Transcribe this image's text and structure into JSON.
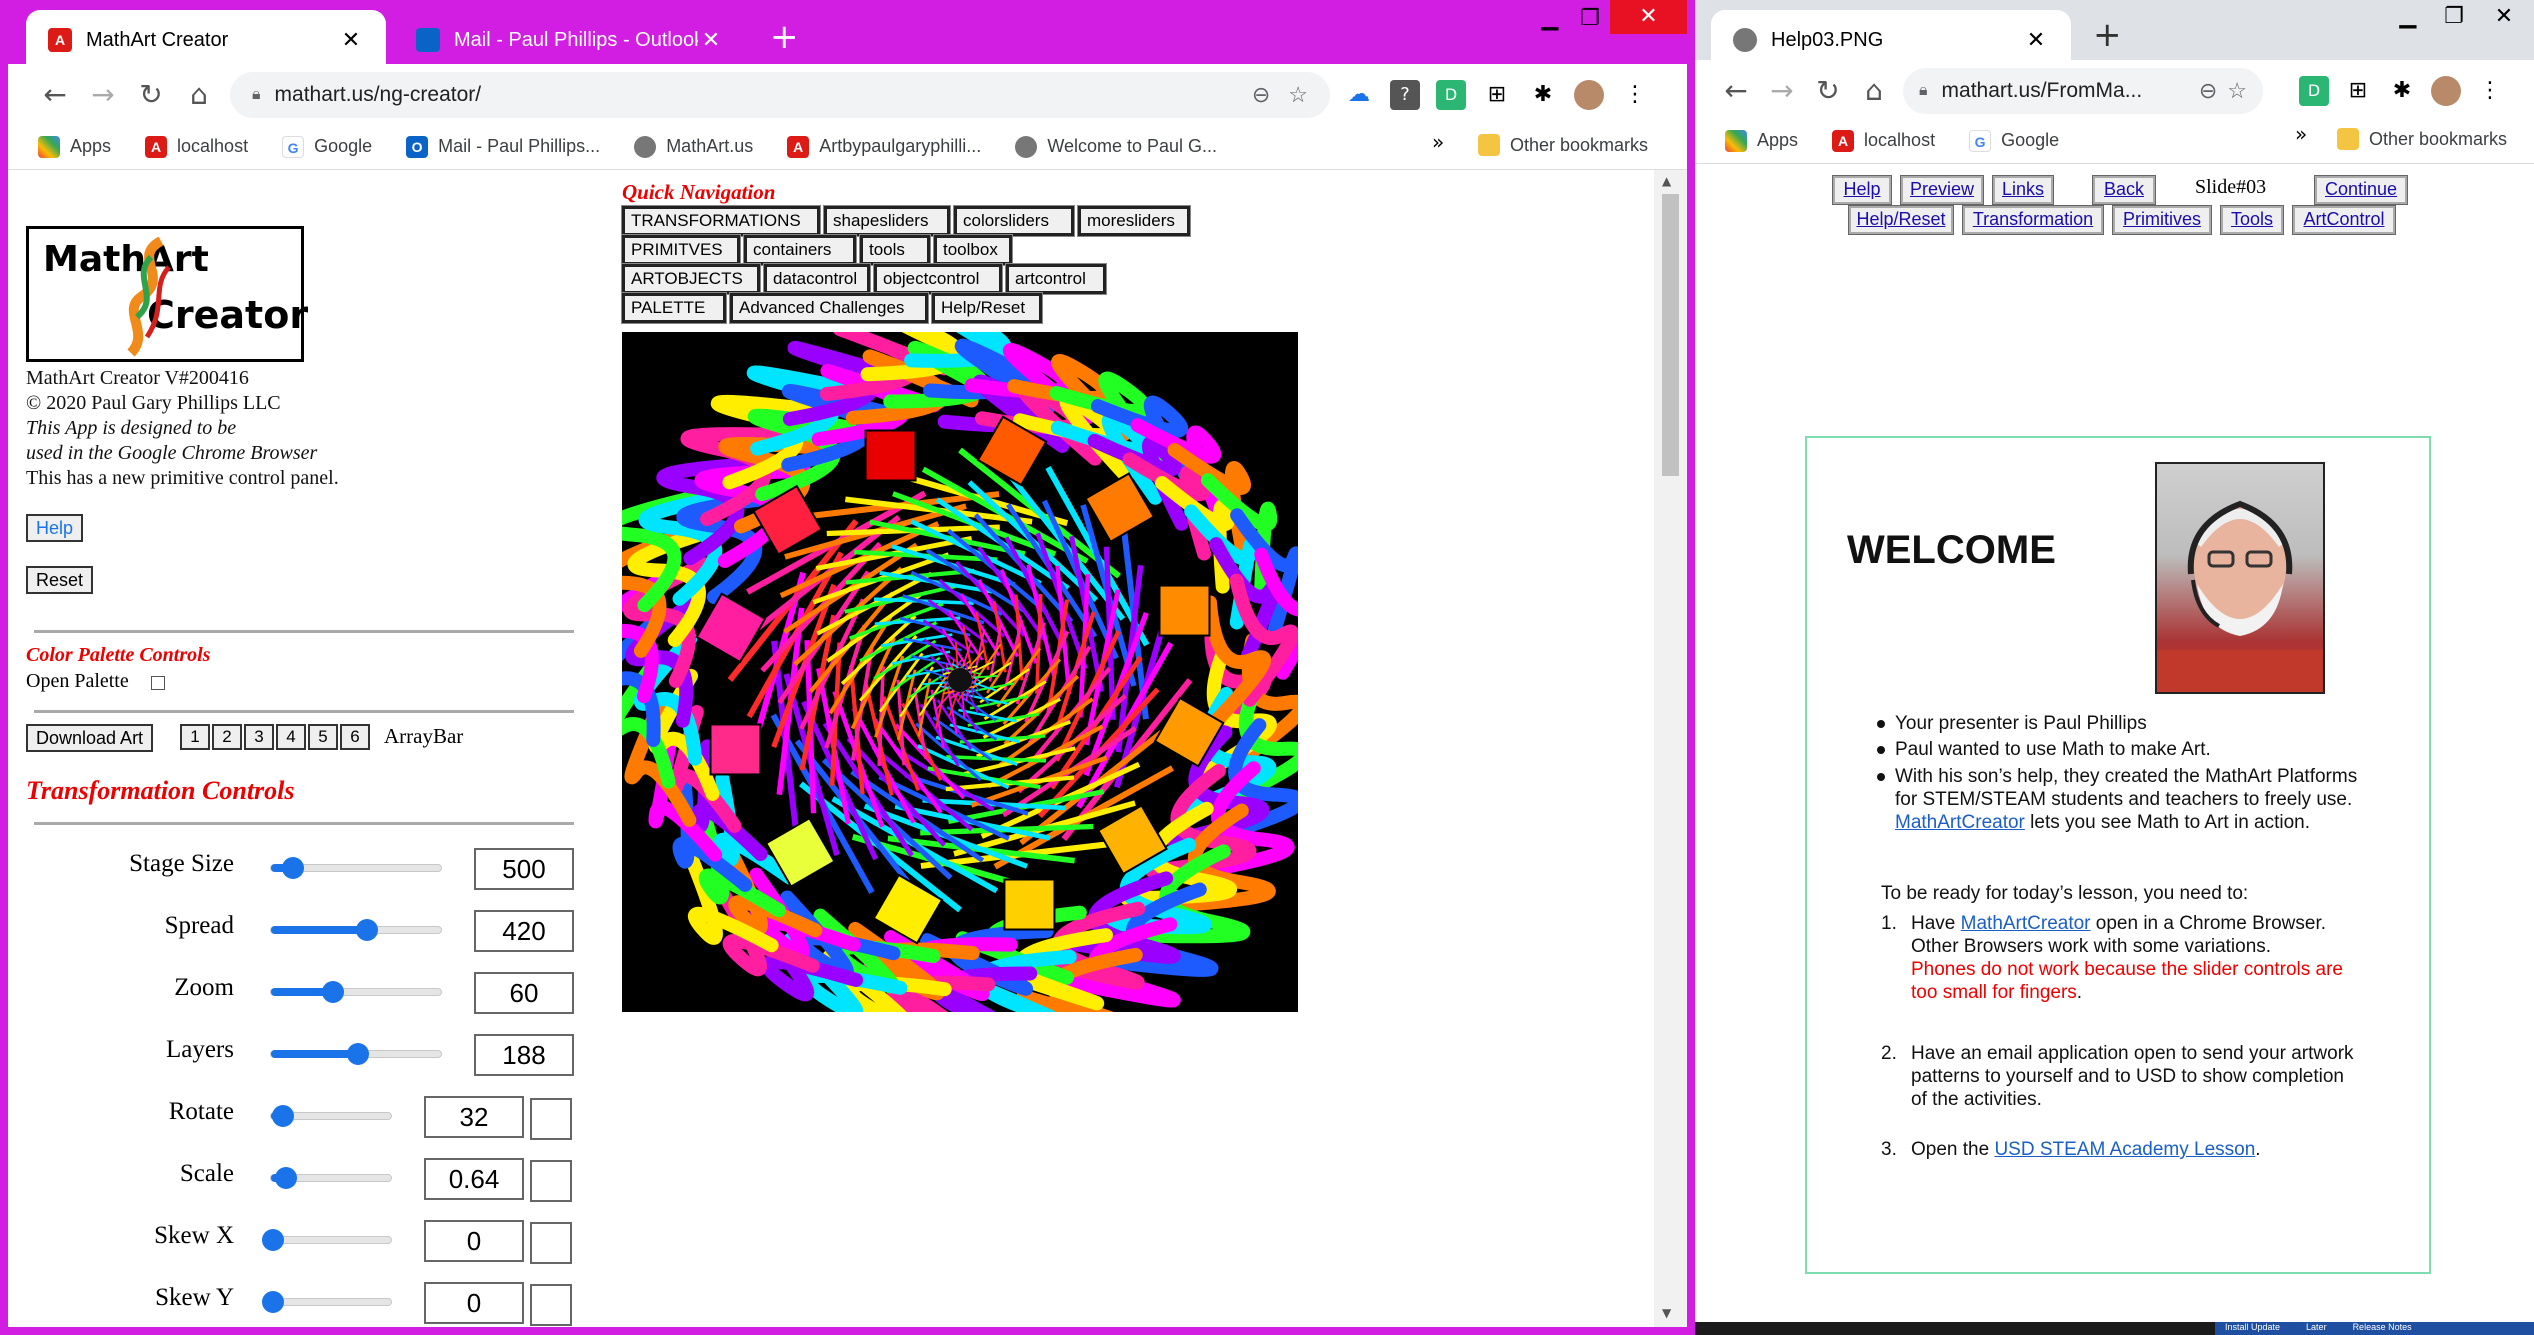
{
  "left_window": {
    "tabs": [
      {
        "title": "MathArt Creator",
        "active": true
      },
      {
        "title": "Mail - Paul Phillips - Outlook",
        "active": false
      }
    ],
    "url": "mathart.us/ng-creator/",
    "bookmarks": [
      "Apps",
      "localhost",
      "Google",
      "Mail - Paul Phillips...",
      "MathArt.us",
      "Artbypaulgaryphilli...",
      "Welcome to Paul G..."
    ],
    "other_bookmarks": "Other bookmarks",
    "overflow": "»",
    "app": {
      "logo": {
        "line1": "MathArt",
        "line2": "Creator"
      },
      "info": [
        "MathArt Creator V#200416",
        "© 2020 Paul Gary Phillips LLC"
      ],
      "info_italic": [
        "This App is designed to be",
        "used in the Google Chrome Browser"
      ],
      "info_extra": "This has a new primitive control panel.",
      "help_button": "Help",
      "reset_button": "Reset",
      "color_palette_heading": "Color Palette Controls",
      "open_palette_label": "Open Palette",
      "download_button": "Download Art",
      "array_buttons": [
        "1",
        "2",
        "3",
        "4",
        "5",
        "6"
      ],
      "array_bar_label": "ArrayBar",
      "transformation_heading": "Transformation Controls",
      "sliders": [
        {
          "label": "Stage Size",
          "value": "500",
          "level": 0.12,
          "wide": true
        },
        {
          "label": "Spread",
          "value": "420",
          "level": 0.55,
          "wide": true
        },
        {
          "label": "Zoom",
          "value": "60",
          "level": 0.35,
          "wide": true
        },
        {
          "label": "Layers",
          "value": "188",
          "level": 0.5,
          "wide": true
        },
        {
          "label": "Rotate",
          "value": "32",
          "level": 0.08,
          "wide": false
        },
        {
          "label": "Scale",
          "value": "0.64",
          "level": 0.11,
          "wide": false
        },
        {
          "label": "Skew X",
          "value": "0",
          "level": 0.0,
          "wide": false
        },
        {
          "label": "Skew Y",
          "value": "0",
          "level": 0.0,
          "wide": false
        }
      ],
      "quick_nav_heading": "Quick Navigation",
      "nav_rows": [
        [
          "TRANSFORMATIONS",
          "shapesliders",
          "colorsliders",
          "moresliders"
        ],
        [
          "PRIMITVES",
          "containers",
          "tools",
          "toolbox"
        ],
        [
          "ARTOBJECTS",
          "datacontrol",
          "objectcontrol",
          "artcontrol"
        ],
        [
          "PALETTE",
          "Advanced Challenges",
          "Help/Reset"
        ]
      ]
    }
  },
  "right_window": {
    "tab": "Help03.PNG",
    "url": "mathart.us/FromMa...",
    "bookmarks": [
      "Apps",
      "localhost",
      "Google"
    ],
    "other_bookmarks": "Other bookmarks",
    "overflow": "»",
    "links_row1": [
      "Help",
      "Preview",
      "Links",
      "Back"
    ],
    "slide_label": "Slide#03",
    "continue": "Continue",
    "links_row2": [
      "Help/Reset",
      "Transformation",
      "Primitives",
      "Tools",
      "ArtControl"
    ],
    "slide": {
      "heading": "WELCOME",
      "bullets": [
        "Your presenter is Paul Phillips",
        "Paul wanted to use Math to make Art.",
        "With his son’s help, they created the MathArt Platforms",
        "for STEM/STEAM students and teachers to freely use.",
        "MathArtCreator",
        " lets you see Math to Art in action."
      ],
      "ready": "To be ready for today’s lesson, you need to:",
      "step1": {
        "num": "1.",
        "a": "Have ",
        "link": "MathArtCreator",
        "b": " open in a Chrome Browser.",
        "c": "Other Browsers work with some variations.",
        "red1": "Phones do not work because the slider controls are",
        "red2": "too small for fingers",
        "dot": "."
      },
      "step2": {
        "num": "2.",
        "l1": "Have an email application open to send your artwork",
        "l2": "patterns to yourself and to USD to show completion",
        "l3": "of the activities."
      },
      "step3": {
        "num": "3.",
        "a": "Open the ",
        "link": "USD STEAM Academy Lesson",
        "dot": "."
      }
    }
  },
  "taskbar_hint": [
    "Install Update",
    "Later",
    "Release Notes"
  ],
  "colors": {
    "window_frame": "#d21ee2",
    "accent": "#1a73e8",
    "heading_red": "#e00000"
  }
}
